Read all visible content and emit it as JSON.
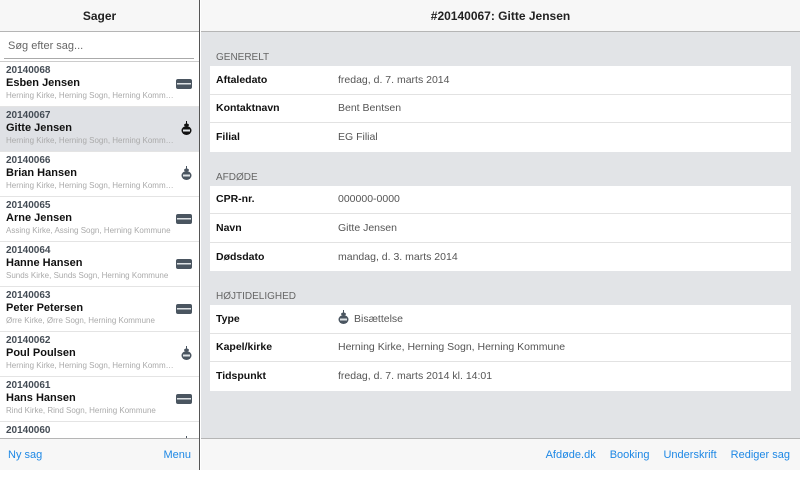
{
  "left": {
    "title": "Sager",
    "search_placeholder": "Søg efter sag...",
    "items": [
      {
        "num": "20140068",
        "name": "Esben Jensen",
        "addr": "Herning Kirke, Herning Sogn, Herning Kommune",
        "icon": "coffin"
      },
      {
        "num": "20140067",
        "name": "Gitte Jensen",
        "addr": "Herning Kirke, Herning Sogn, Herning Kommune",
        "icon": "urn"
      },
      {
        "num": "20140066",
        "name": "Brian Hansen",
        "addr": "Herning Kirke, Herning Sogn, Herning Kommune",
        "icon": "urn"
      },
      {
        "num": "20140065",
        "name": "Arne Jensen",
        "addr": "Assing Kirke, Assing Sogn, Herning Kommune",
        "icon": "coffin"
      },
      {
        "num": "20140064",
        "name": "Hanne Hansen",
        "addr": "Sunds Kirke, Sunds Sogn, Herning Kommune",
        "icon": "coffin"
      },
      {
        "num": "20140063",
        "name": "Peter Petersen",
        "addr": "Ørre Kirke, Ørre Sogn, Herning Kommune",
        "icon": "coffin"
      },
      {
        "num": "20140062",
        "name": "Poul Poulsen",
        "addr": "Herning Kirke, Herning Sogn, Herning Kommune",
        "icon": "urn"
      },
      {
        "num": "20140061",
        "name": "Hans Hansen",
        "addr": "Rind Kirke, Rind Sogn, Herning Kommune",
        "icon": "coffin"
      },
      {
        "num": "20140060",
        "name": "",
        "addr": "",
        "icon": "urn"
      }
    ],
    "footer": {
      "new": "Ny sag",
      "menu": "Menu"
    }
  },
  "right": {
    "title": "#20140067: Gitte Jensen",
    "sections": [
      {
        "title": "GENERELT",
        "rows": [
          {
            "label": "Aftaledato",
            "value": "fredag, d. 7. marts 2014"
          },
          {
            "label": "Kontaktnavn",
            "value": "Bent Bentsen"
          },
          {
            "label": "Filial",
            "value": "EG Filial"
          }
        ]
      },
      {
        "title": "AFDØDE",
        "rows": [
          {
            "label": "CPR-nr.",
            "value": "000000-0000"
          },
          {
            "label": "Navn",
            "value": "Gitte Jensen"
          },
          {
            "label": "Dødsdato",
            "value": "mandag, d. 3. marts 2014"
          }
        ]
      },
      {
        "title": "HØJTIDELIGHED",
        "rows": [
          {
            "label": "Type",
            "value": "Bisættelse",
            "icon": "urn"
          },
          {
            "label": "Kapel/kirke",
            "value": "Herning Kirke, Herning Sogn, Herning Kommune"
          },
          {
            "label": "Tidspunkt",
            "value": "fredag, d. 7. marts 2014 kl. 14:01"
          }
        ]
      }
    ],
    "footer": [
      "Afdøde.dk",
      "Booking",
      "Underskrift",
      "Rediger sag"
    ]
  },
  "colors": {
    "accent": "#1e88e5",
    "selected": "#dfe1e5",
    "panel": "#e2e4e7"
  }
}
